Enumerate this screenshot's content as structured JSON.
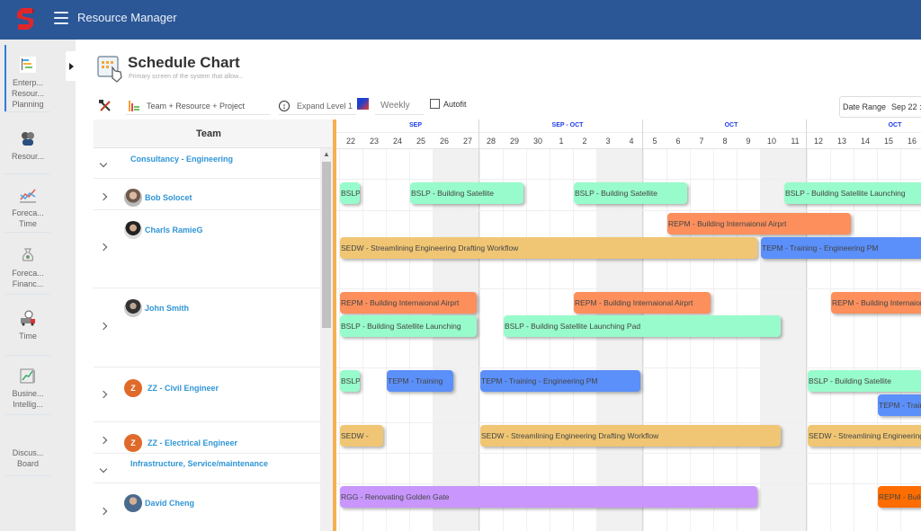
{
  "app": {
    "title": "Resource Manager"
  },
  "nav": {
    "items": [
      {
        "label": "Enterp... Resour... Planning",
        "icon": "gantt-chart-icon",
        "active": true
      },
      {
        "label": "Resour...",
        "icon": "people-icon"
      },
      {
        "label": "Foreca... Time",
        "icon": "line-chart-icon"
      },
      {
        "label": "Foreca... Financ...",
        "icon": "money-bag-icon"
      },
      {
        "label": "Time",
        "icon": "truck-clock-icon"
      },
      {
        "label": "Busine... Intellig...",
        "icon": "bi-chart-icon"
      },
      {
        "label": "Discus... Board",
        "icon": ""
      }
    ]
  },
  "page": {
    "title": "Schedule Chart",
    "subtitle": "Primary screen of the system that allow..."
  },
  "toolbar": {
    "view": "Team + Resource + Project",
    "expand": "Expand Level 1",
    "period": "Weekly",
    "autofit_label": "Autofit",
    "autofit_checked": false,
    "date_range_label": "Date Range",
    "date_range_value": "Sep 22 :"
  },
  "grid": {
    "team_header": "Team",
    "months": [
      "SEP",
      "SEP - OCT",
      "OCT",
      "OCT"
    ],
    "days": [
      "22",
      "23",
      "24",
      "25",
      "26",
      "27",
      "28",
      "29",
      "30",
      "1",
      "2",
      "3",
      "4",
      "5",
      "6",
      "7",
      "8",
      "9",
      "10",
      "11",
      "12",
      "13",
      "14",
      "15",
      "16"
    ],
    "weekend_days": [
      4,
      5,
      11,
      12,
      18,
      19
    ],
    "rows": [
      {
        "type": "group",
        "label": "Consultancy - Engineering",
        "expanded": true
      },
      {
        "type": "person",
        "label": "Bob Solocet"
      },
      {
        "type": "person",
        "label": "Charls RamieG"
      },
      {
        "type": "person",
        "label": "John Smith"
      },
      {
        "type": "person",
        "label": "ZZ - Civil Engineer",
        "initial": "Z"
      },
      {
        "type": "person",
        "label": "ZZ - Electrical Engineer",
        "initial": "Z"
      },
      {
        "type": "group",
        "label": "Infrastructure, Service/maintenance",
        "expanded": true
      },
      {
        "type": "person",
        "label": "David Cheng"
      }
    ]
  },
  "colors": {
    "BSLP": "#98fbcb",
    "SEDW": "#f0c674",
    "REPM": "#fc8f5c",
    "TEPM": "#5b8ff9",
    "RGG": "#c896fc",
    "REPM_alt": "#ff6d00"
  },
  "bars": [
    {
      "label": "BSLP",
      "code": "BSLP",
      "start": 0,
      "days": 1,
      "lane": 0
    },
    {
      "label": "BSLP - Building Satellite",
      "code": "BSLP",
      "start": 3,
      "days": 5,
      "lane": 0
    },
    {
      "label": "BSLP - Building Satellite",
      "code": "BSLP",
      "start": 10,
      "days": 5,
      "lane": 0
    },
    {
      "label": "BSLP - Building Satellite Launching",
      "code": "BSLP",
      "start": 19,
      "days": 7,
      "lane": 0
    },
    {
      "label": "REPM - Building Internaional Airprt",
      "code": "REPM",
      "start": 14,
      "days": 8,
      "lane": 1
    },
    {
      "label": "SEDW - Streamlining Engineering Drafting Workflow",
      "code": "SEDW",
      "start": 0,
      "days": 18,
      "lane": 2
    },
    {
      "label": "TEPM - Training - Engineering PM",
      "code": "TEPM",
      "start": 18,
      "days": 8,
      "lane": 2
    },
    {
      "label": "REPM - Building Internaional Airprt",
      "code": "REPM",
      "start": 0,
      "days": 6,
      "lane": 3
    },
    {
      "label": "REPM - Building Internaional Airprt",
      "code": "REPM",
      "start": 10,
      "days": 6,
      "lane": 3
    },
    {
      "label": "REPM - Building Internaional Airprt",
      "code": "REPM",
      "start": 21,
      "days": 5,
      "lane": 3
    },
    {
      "label": "BSLP - Building Satellite Launching",
      "code": "BSLP",
      "start": 0,
      "days": 6,
      "lane": 4
    },
    {
      "label": "BSLP - Building Satellite Launching Pad",
      "code": "BSLP",
      "start": 7,
      "days": 12,
      "lane": 4
    },
    {
      "label": "BSLP",
      "code": "BSLP",
      "start": 0,
      "days": 1,
      "lane": 5
    },
    {
      "label": "TEPM - Training",
      "code": "TEPM",
      "start": 2,
      "days": 3,
      "lane": 5
    },
    {
      "label": "TEPM - Training - Engineering PM",
      "code": "TEPM",
      "start": 6,
      "days": 7,
      "lane": 5
    },
    {
      "label": "BSLP - Building Satellite",
      "code": "BSLP",
      "start": 20,
      "days": 6,
      "lane": 5
    },
    {
      "label": "TEPM - Training",
      "code": "TEPM",
      "start": 23,
      "days": 3,
      "lane": 6
    },
    {
      "label": "SEDW -",
      "code": "SEDW",
      "start": 0,
      "days": 2,
      "lane": 7
    },
    {
      "label": "SEDW - Streamlining Engineering Drafting Workflow",
      "code": "SEDW",
      "start": 6,
      "days": 13,
      "lane": 7
    },
    {
      "label": "SEDW - Streamlining Engineering Drafting Workflow",
      "code": "SEDW",
      "start": 20,
      "days": 6,
      "lane": 7
    },
    {
      "label": "RGG - Renovating Golden Gate",
      "code": "RGG",
      "start": 0,
      "days": 18,
      "lane": 8
    },
    {
      "label": "REPM - Building Internaional Airprt",
      "code": "REPM_alt",
      "start": 23,
      "days": 3,
      "lane": 8
    }
  ]
}
